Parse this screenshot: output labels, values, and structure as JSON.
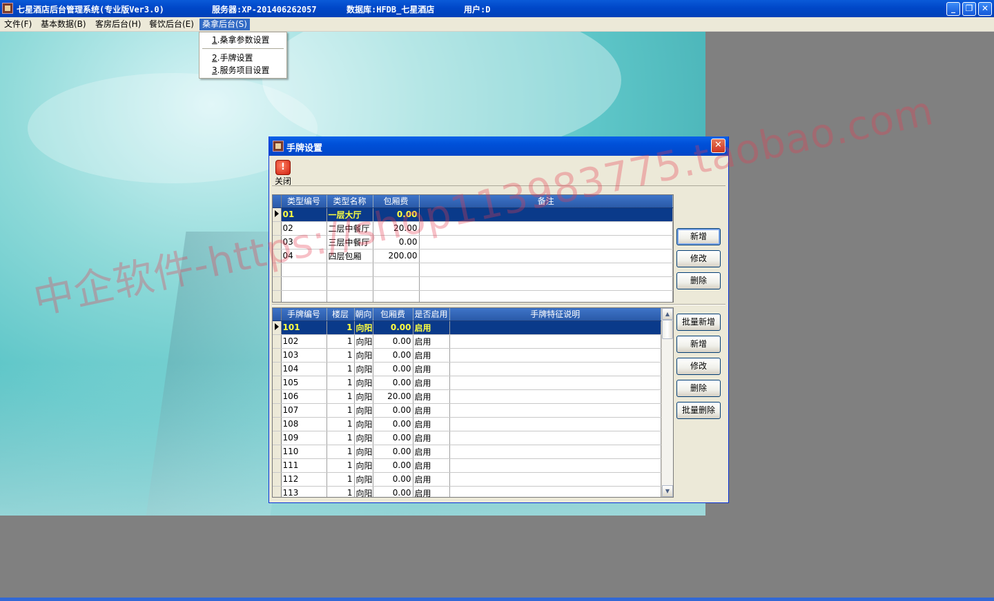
{
  "window": {
    "title": "七星酒店后台管理系统(专业版Ver3.0)",
    "server": "服务器:XP-20140626205­7",
    "database": "数据库:HFDB_七星酒店",
    "user": "用户:D",
    "min_btn": "_",
    "max_btn": "❐",
    "close_btn": "✕"
  },
  "menu": [
    {
      "label": "文件(F)"
    },
    {
      "label": "基本数据(B)"
    },
    {
      "label": "客房后台(H)"
    },
    {
      "label": "餐饮后台(E)"
    },
    {
      "label": "桑拿后台(S)"
    }
  ],
  "dropdown": {
    "items": [
      {
        "num": "1",
        "label": ".桑拿参数设置"
      },
      {
        "num": "2",
        "label": ".手牌设置"
      },
      {
        "num": "3",
        "label": ".服务项目设置"
      }
    ]
  },
  "dialog": {
    "title": "手牌设置",
    "close_glyph": "✕",
    "toolbar": {
      "close_label": "关闭",
      "close_glyph": "!"
    }
  },
  "type_grid": {
    "headers": [
      "类型编号",
      "类型名称",
      "包厢费",
      "备注"
    ],
    "rows": [
      {
        "code": "01",
        "name": "一层大厅",
        "fee": "0.00",
        "note": ""
      },
      {
        "code": "02",
        "name": "二层中餐厅",
        "fee": "20.00",
        "note": ""
      },
      {
        "code": "03",
        "name": "三层中餐厅",
        "fee": "0.00",
        "note": ""
      },
      {
        "code": "04",
        "name": "四层包厢",
        "fee": "200.00",
        "note": ""
      }
    ]
  },
  "type_buttons": {
    "add": "新增",
    "edit": "修改",
    "delete": "删除"
  },
  "tag_grid": {
    "headers": [
      "手牌编号",
      "楼层",
      "朝向",
      "包厢费",
      "是否启用",
      "手牌特征说明"
    ],
    "rows": [
      {
        "code": "101",
        "floor": "1",
        "dir": "向阳",
        "fee": "0.00",
        "enabled": "启用"
      },
      {
        "code": "102",
        "floor": "1",
        "dir": "向阳",
        "fee": "0.00",
        "enabled": "启用"
      },
      {
        "code": "103",
        "floor": "1",
        "dir": "向阳",
        "fee": "0.00",
        "enabled": "启用"
      },
      {
        "code": "104",
        "floor": "1",
        "dir": "向阳",
        "fee": "0.00",
        "enabled": "启用"
      },
      {
        "code": "105",
        "floor": "1",
        "dir": "向阳",
        "fee": "0.00",
        "enabled": "启用"
      },
      {
        "code": "106",
        "floor": "1",
        "dir": "向阳",
        "fee": "20.00",
        "enabled": "启用"
      },
      {
        "code": "107",
        "floor": "1",
        "dir": "向阳",
        "fee": "0.00",
        "enabled": "启用"
      },
      {
        "code": "108",
        "floor": "1",
        "dir": "向阳",
        "fee": "0.00",
        "enabled": "启用"
      },
      {
        "code": "109",
        "floor": "1",
        "dir": "向阳",
        "fee": "0.00",
        "enabled": "启用"
      },
      {
        "code": "110",
        "floor": "1",
        "dir": "向阳",
        "fee": "0.00",
        "enabled": "启用"
      },
      {
        "code": "111",
        "floor": "1",
        "dir": "向阳",
        "fee": "0.00",
        "enabled": "启用"
      },
      {
        "code": "112",
        "floor": "1",
        "dir": "向阳",
        "fee": "0.00",
        "enabled": "启用"
      },
      {
        "code": "113",
        "floor": "1",
        "dir": "向阳",
        "fee": "0.00",
        "enabled": "启用"
      }
    ]
  },
  "tag_buttons": {
    "batch_add": "批量新增",
    "add": "新增",
    "edit": "修改",
    "delete": "删除",
    "batch_delete": "批量删除"
  },
  "scroll": {
    "up": "▲",
    "down": "▼"
  },
  "watermark": "中企软件-https://shop113983775.taobao.com",
  "colors": {
    "title_blue": "#0047c8",
    "selected_row": "#0a3a8a",
    "selected_text": "#ffff40",
    "grid_header": "#2a5aa8"
  }
}
